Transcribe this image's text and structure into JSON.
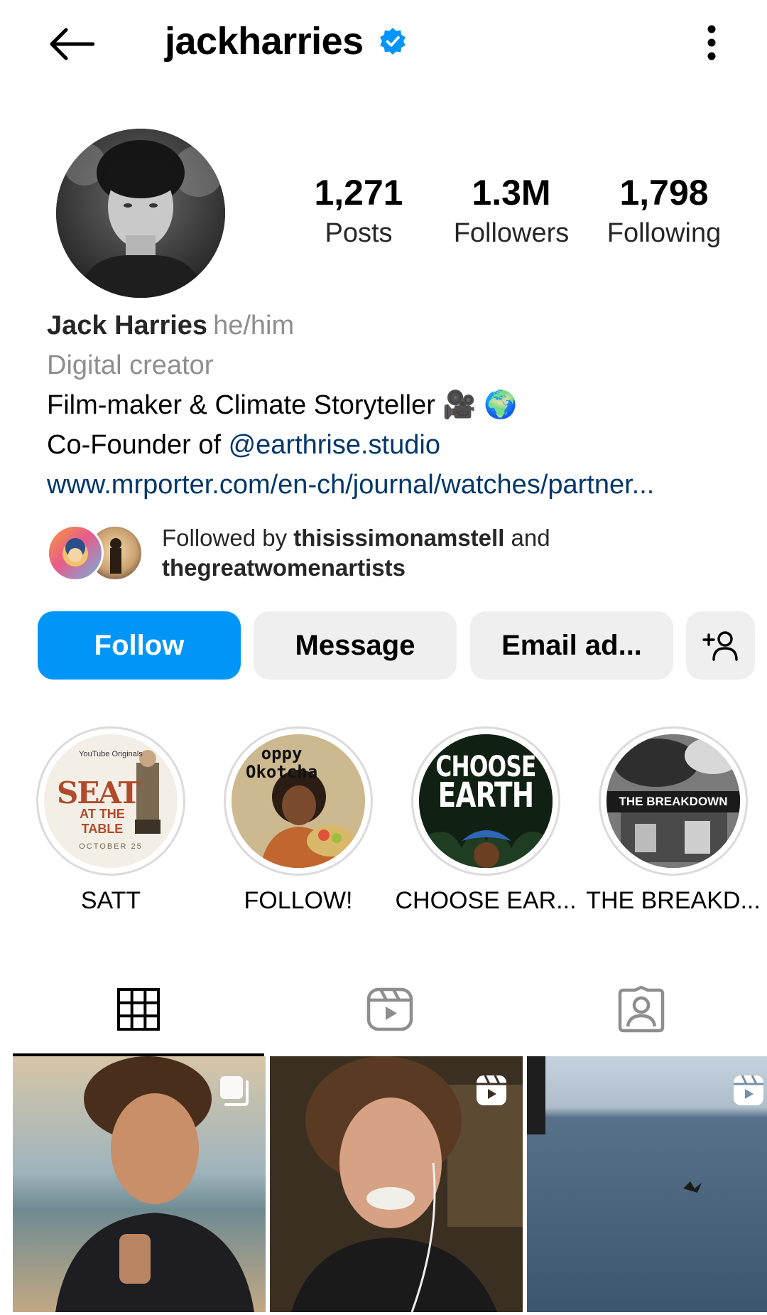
{
  "header": {
    "username": "jackharries",
    "verified": true
  },
  "stats": [
    {
      "value": "1,271",
      "label": "Posts"
    },
    {
      "value": "1.3M",
      "label": "Followers"
    },
    {
      "value": "1,798",
      "label": "Following"
    }
  ],
  "bio": {
    "name": "Jack Harries",
    "pronouns": "he/him",
    "category": "Digital creator",
    "line1": "Film-maker & Climate Storyteller 🎥 🌍",
    "line2_prefix": "Co-Founder of ",
    "mention": "@earthrise.studio",
    "link": "www.mrporter.com/en-ch/journal/watches/partner..."
  },
  "followed_by": {
    "prefix": "Followed by ",
    "user1": "thisissimonamstell",
    "joiner": " and",
    "user2": "thegreatwomenartists"
  },
  "actions": {
    "follow": "Follow",
    "message": "Message",
    "email": "Email ad..."
  },
  "highlights": [
    {
      "label": "SATT",
      "img_text1": "SEAT",
      "img_text2": "AT THE TABLE",
      "img_text3": "OCTOBER 25",
      "img_text4": "YouTube Originals"
    },
    {
      "label": "FOLLOW!",
      "img_text1": "oppy",
      "img_text2": "Okotcha"
    },
    {
      "label": "CHOOSE EAR...",
      "img_text1": "CHOOSE",
      "img_text2": "EARTH"
    },
    {
      "label": "THE BREAKD...",
      "img_text1": "THE BREAKDOWN"
    }
  ],
  "colors": {
    "accent": "#0095f6",
    "link": "#00376b",
    "verified": "#0095f6",
    "muted": "#8e8e8e"
  }
}
